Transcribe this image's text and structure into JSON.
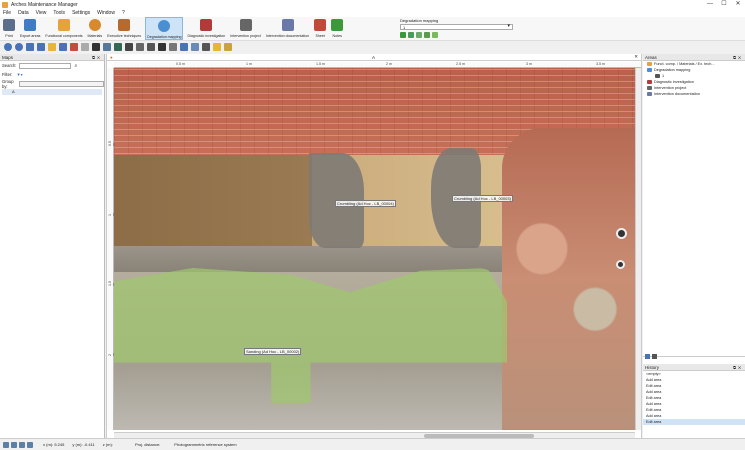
{
  "window": {
    "title": "Arches Maintenance Manager",
    "controls": {
      "minimize": "—",
      "maximize": "☐",
      "close": "✕"
    }
  },
  "menu": [
    "File",
    "Data",
    "View",
    "Tools",
    "Settings",
    "Window",
    "?"
  ],
  "ribbon": {
    "buttons": [
      {
        "label": "Print",
        "icon": "printer-icon",
        "color": "#5b6f8a"
      },
      {
        "label": "Export areas",
        "icon": "export-icon",
        "color": "#3e7cc4"
      },
      {
        "label": "Functional components",
        "icon": "components-icon",
        "color": "#e8a23a"
      },
      {
        "label": "Materials",
        "icon": "palette-icon",
        "color": "#d7892e"
      },
      {
        "label": "Executive techniques",
        "icon": "hammer-icon",
        "color": "#b76a2c"
      },
      {
        "label": "Degradation mapping",
        "icon": "clock-icon",
        "color": "#4c8fd1"
      },
      {
        "label": "Diagnostic investigation",
        "icon": "book-icon",
        "color": "#b23a3a"
      },
      {
        "label": "Intervention project",
        "icon": "trowel-icon",
        "color": "#666666"
      },
      {
        "label": "Intervention documentation",
        "icon": "document-icon",
        "color": "#6a78a8"
      },
      {
        "label": "Sheet",
        "icon": "books-icon",
        "color": "#c2493a"
      },
      {
        "label": "Notes",
        "icon": "pencil-icon",
        "color": "#3a9a3a"
      }
    ],
    "active_index": 5,
    "degradation_group": {
      "caption": "Degradation mapping",
      "selected": "1"
    }
  },
  "left_panel": {
    "title": "Maps",
    "search_label": "Search:",
    "filter_label": "Filter:",
    "group_by_label": "Group by:",
    "tree_root": "A"
  },
  "map": {
    "tab_title": "A",
    "ruler_top": [
      "0.5 m",
      "1 m",
      "1.5 m",
      "2 m",
      "2.5 m",
      "3 m",
      "3.5 m",
      "4 m"
    ],
    "ruler_left": [
      "0.5 m",
      "1 m",
      "1.5 m",
      "2 m"
    ],
    "annotations": [
      "Crumbling (Ad Hoc - LB_00004)",
      "Crumbling (Ad Hoc - LB_00003)",
      "Sanding (Ad Hoc - LB_00002)"
    ]
  },
  "right_panel": {
    "title": "Areas",
    "tree": [
      "Funct. comp. / Materials / Ex. tech...",
      "Degradation mapping",
      "1",
      "Diagnostic investigation",
      "Intervention project",
      "Intervention documentation"
    ],
    "history_title": "History",
    "history": [
      "<empty>",
      "Add area",
      "Edit area",
      "Add area",
      "Edit area",
      "Add area",
      "Edit area",
      "Add area",
      "Edit area"
    ],
    "history_selected": 8
  },
  "status": {
    "x_m": "x (m): 5.245",
    "y_m": "y (m): -0.411",
    "z_m": "z (m):",
    "proj_distance": "Proj. distance:",
    "reference": "Photogrammetric reference system"
  }
}
